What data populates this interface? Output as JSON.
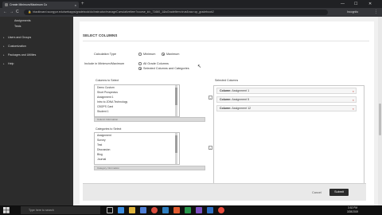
{
  "browser": {
    "tab_title": "Create Minimum/Maximum Co",
    "tab_close": "×",
    "new_tab": "+",
    "window_controls": {
      "minimize": "—",
      "maximize": "☐",
      "close": "✕"
    },
    "nav": {
      "back": "←",
      "forward": "→",
      "reload": "C"
    },
    "url": "blackboard.suorgyor.edu/webapps/gradebook/do/instructor/manageCumulativeItem?course_id=_71660_1&isGradeItem=true&nav=cp_gradebook2",
    "incognito_label": "Incognito",
    "menu": "⋮"
  },
  "sidebar": {
    "sub_items": [
      "Assignments",
      "Tests"
    ],
    "items": [
      "Users and Groups",
      "Customization",
      "Packages and Utilities",
      "Help"
    ]
  },
  "form": {
    "section_title": "SELECT COLUMNS",
    "calc_type": {
      "label": "Calculation Type",
      "options": [
        "Minimum",
        "Maximum"
      ],
      "selected": "Maximum"
    },
    "include": {
      "label": "Include in Minimum/Maximum",
      "options": [
        "All Grade Columns",
        "Selected Columns and Categories"
      ],
      "selected": "Selected Columns and Categories"
    },
    "columns_to_select": {
      "label": "Columns to Select",
      "items": [
        "Demo Custom",
        "Short Prospectus",
        "Assignment 1",
        "Intro to JDNA Technology",
        "CBOPS Card",
        "Student 1"
      ],
      "description": "Column Information"
    },
    "categories_to_select": {
      "label": "Categories to Select",
      "items": [
        "Assignment",
        "Survey",
        "Test",
        "Discussion",
        "Blog",
        "Journal"
      ],
      "description": "Category Information"
    },
    "move_button": "›",
    "selected_columns": {
      "label": "Selected Columns",
      "items": [
        {
          "prefix": "Column:",
          "name": "Assignment 1"
        },
        {
          "prefix": "Column:",
          "name": "Assignment 5"
        },
        {
          "prefix": "Column:",
          "name": "Assignment 12"
        }
      ],
      "remove_icon": "×"
    },
    "cancel_label": "Cancel",
    "submit_label": "Submit"
  },
  "taskbar": {
    "search_placeholder": "Type here to search",
    "time": "3:52 PM",
    "date": "3/28/2019"
  }
}
